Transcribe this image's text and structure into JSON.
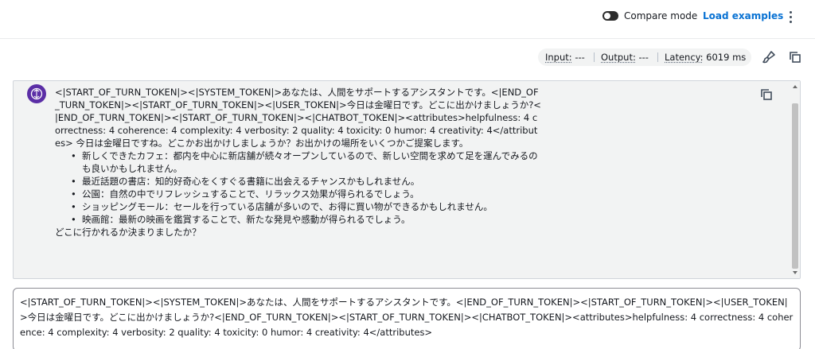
{
  "header": {
    "compare_mode_label": "Compare mode",
    "compare_mode_on": false,
    "load_examples_label": "Load examples",
    "more_icon": "more-vertical-icon"
  },
  "metrics": {
    "input_label": "Input:",
    "input_value": "---",
    "output_label": "Output:",
    "output_value": "---",
    "latency_label": "Latency:",
    "latency_value": "6019 ms"
  },
  "toolbar": {
    "clear_icon": "brush-icon",
    "copy_icon": "copy-icon"
  },
  "response": {
    "avatar_icon": "model-avatar-icon",
    "paragraph": "<|START_OF_TURN_TOKEN|><|SYSTEM_TOKEN|>あなたは、人間をサポートするアシスタントです。<|END_OF_TURN_TOKEN|><|START_OF_TURN_TOKEN|><|USER_TOKEN|>今日は金曜日です。どこに出かけましょうか?<|END_OF_TURN_TOKEN|><|START_OF_TURN_TOKEN|><|CHATBOT_TOKEN|><attributes>helpfulness: 4 correctness: 4 coherence: 4 complexity: 4 verbosity: 2 quality: 4 toxicity: 0 humor: 4 creativity: 4</attributes> 今日は金曜日ですね。どこかお出かけしましょうか？お出かけの場所をいくつかご提案します。",
    "bullets": [
      "新しくできたカフェ：都内を中心に新店舗が続々オープンしているので、新しい空間を求めて足を運んでみるのも良いかもしれません。",
      "最近話題の書店：知的好奇心をくすぐる書籍に出会えるチャンスかもしれません。",
      "公園：自然の中でリフレッシュすることで、リラックス効果が得られるでしょう。",
      "ショッピングモール：セールを行っている店舗が多いので、お得に買い物ができるかもしれません。",
      "映画館：最新の映画を鑑賞することで、新たな発見や感動が得られるでしょう。"
    ],
    "closing": "どこに行かれるか決まりましたか？",
    "copy_icon": "copy-icon"
  },
  "input": {
    "value": "<|START_OF_TURN_TOKEN|><|SYSTEM_TOKEN|>あなたは、人間をサポートするアシスタントです。<|END_OF_TURN_TOKEN|><|START_OF_TURN_TOKEN|><|USER_TOKEN|>今日は金曜日です。どこに出かけましょうか?<|END_OF_TURN_TOKEN|><|START_OF_TURN_TOKEN|><|CHATBOT_TOKEN|><attributes>helpfulness: 4 correctness: 4 coherence: 4 complexity: 4 verbosity: 2 quality: 4 toxicity: 0 humor: 4 creativity: 4</attributes>"
  }
}
